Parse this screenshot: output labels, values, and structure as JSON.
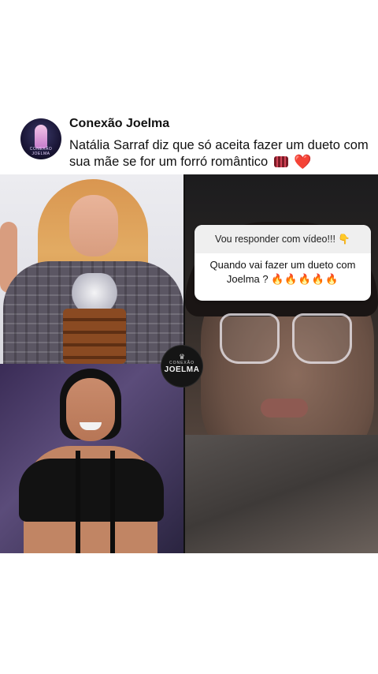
{
  "post": {
    "account_name": "Conexão Joelma",
    "caption": "Natália Sarraf diz que só aceita fazer um dueto com sua mãe se for um forró romântico",
    "caption_emojis": [
      "accordion-emoji",
      "red-heart-emoji"
    ],
    "heart_glyph": "❤️"
  },
  "avatar": {
    "logo_text": "CONEXÃO JOELMA"
  },
  "story": {
    "reply_header": "Vou responder com vídeo!!! 👇",
    "question": "Quando vai fazer um dueto com Joelma ?",
    "question_emojis": "🔥🔥🔥🔥🔥"
  },
  "watermark": {
    "small": "CONEXÃO",
    "big": "JOELMA",
    "crown": "♛"
  },
  "colors": {
    "background": "#ffffff",
    "heart": "#e0142b",
    "question_header_bg": "#efefef"
  }
}
